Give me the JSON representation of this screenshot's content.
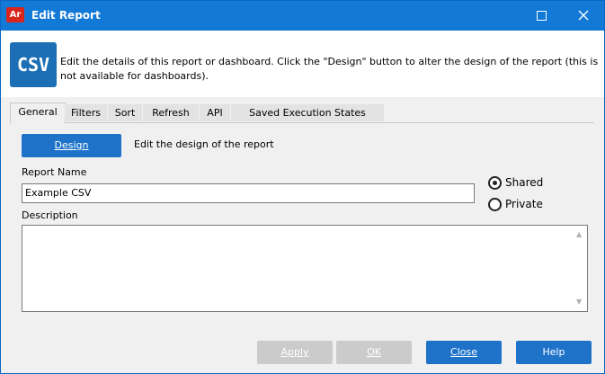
{
  "window": {
    "app_icon_text": "Ar",
    "title": "Edit Report"
  },
  "header": {
    "logo_text": "CSV",
    "description": "Edit the details of this report or dashboard.  Click the \"Design\" button to alter the design of the report (this is not available for dashboards)."
  },
  "tabs": [
    {
      "label": "General",
      "active": true
    },
    {
      "label": "Filters"
    },
    {
      "label": "Sort"
    },
    {
      "label": "Refresh"
    },
    {
      "label": "API"
    },
    {
      "label": "Saved Execution States"
    }
  ],
  "general": {
    "design_button": "Design",
    "design_desc": "Edit the design of the report",
    "report_name_label": "Report Name",
    "report_name_value": "Example CSV",
    "shared_label": "Shared",
    "private_label": "Private",
    "selected_visibility": "Shared",
    "description_label": "Description",
    "description_value": ""
  },
  "buttons": {
    "apply": "Apply",
    "ok": "OK",
    "close": "Close",
    "help": "Help"
  },
  "colors": {
    "titlebar": "#1279d7",
    "primary_button": "#1e73c9",
    "disabled_button": "#cbcbcb"
  }
}
